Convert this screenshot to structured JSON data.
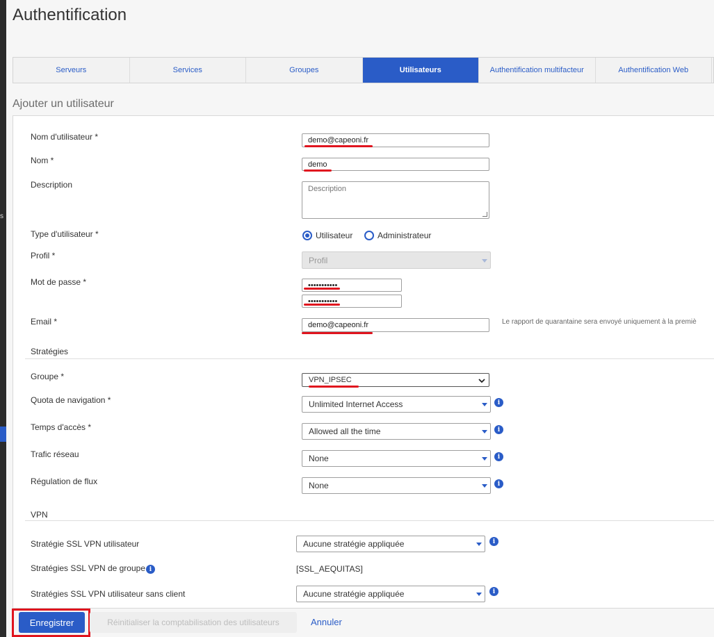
{
  "page": {
    "title": "Authentification",
    "section_title": "Ajouter un utilisateur"
  },
  "tabs": [
    {
      "label": "Serveurs",
      "active": false
    },
    {
      "label": "Services",
      "active": false
    },
    {
      "label": "Groupes",
      "active": false
    },
    {
      "label": "Utilisateurs",
      "active": true
    },
    {
      "label": "Authentification multifacteur",
      "active": false
    },
    {
      "label": "Authentification Web",
      "active": false
    }
  ],
  "form": {
    "username": {
      "label": "Nom d'utilisateur *",
      "value": "demo@capeoni.fr"
    },
    "name": {
      "label": "Nom *",
      "value": "demo"
    },
    "description": {
      "label": "Description",
      "placeholder": "Description",
      "value": ""
    },
    "user_type": {
      "label": "Type d'utilisateur *",
      "options": [
        "Utilisateur",
        "Administrateur"
      ],
      "selected": "Utilisateur"
    },
    "profile": {
      "label": "Profil *",
      "value": "Profil"
    },
    "password": {
      "label": "Mot de passe *",
      "value": "•••••••••••",
      "confirm": "•••••••••••"
    },
    "email": {
      "label": "Email *",
      "value": "demo@capeoni.fr",
      "note": "Le rapport de quarantaine sera envoyé uniquement à la premiè"
    }
  },
  "strategies": {
    "title": "Stratégies",
    "group": {
      "label": "Groupe *",
      "value": "VPN_IPSEC"
    },
    "quota": {
      "label": "Quota de navigation *",
      "value": "Unlimited Internet Access"
    },
    "access_time": {
      "label": "Temps d'accès *",
      "value": "Allowed all the time"
    },
    "traffic": {
      "label": "Trafic réseau",
      "value": "None"
    },
    "flow": {
      "label": "Régulation de flux",
      "value": "None"
    }
  },
  "vpn": {
    "title": "VPN",
    "ssl_user": {
      "label": "Stratégie SSL VPN utilisateur",
      "value": "Aucune stratégie appliquée"
    },
    "ssl_group": {
      "label": "Stratégies SSL VPN de groupe",
      "value": "[SSL_AEQUITAS]"
    },
    "ssl_clientless": {
      "label": "Stratégies SSL VPN utilisateur sans client",
      "value": "Aucune stratégie appliquée"
    }
  },
  "footer": {
    "save": "Enregistrer",
    "reset": "Réinitialiser la comptabilisation des utilisateurs",
    "cancel": "Annuler"
  },
  "colors": {
    "accent": "#2a5cc7",
    "annotation": "#e0141e"
  }
}
